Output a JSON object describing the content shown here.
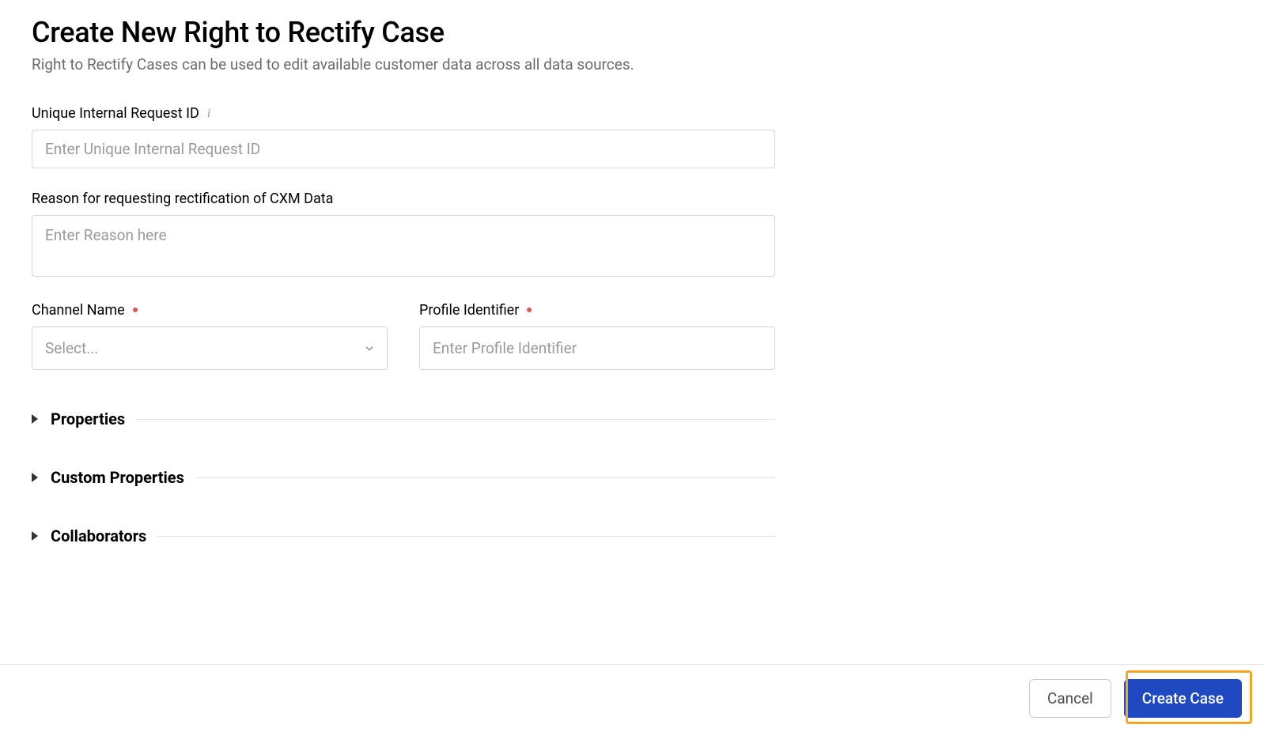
{
  "header": {
    "title": "Create New Right to Rectify Case",
    "subtitle": "Right to Rectify Cases can be used to edit available customer data across all data sources."
  },
  "fields": {
    "request_id": {
      "label": "Unique Internal Request ID",
      "placeholder": "Enter Unique Internal Request ID"
    },
    "reason": {
      "label": "Reason for requesting rectification of CXM Data",
      "placeholder": "Enter Reason here"
    },
    "channel": {
      "label": "Channel Name",
      "placeholder": "Select..."
    },
    "profile": {
      "label": "Profile Identifier",
      "placeholder": "Enter Profile Identifier"
    }
  },
  "sections": {
    "properties": "Properties",
    "custom_properties": "Custom Properties",
    "collaborators": "Collaborators"
  },
  "footer": {
    "cancel": "Cancel",
    "create": "Create Case"
  }
}
